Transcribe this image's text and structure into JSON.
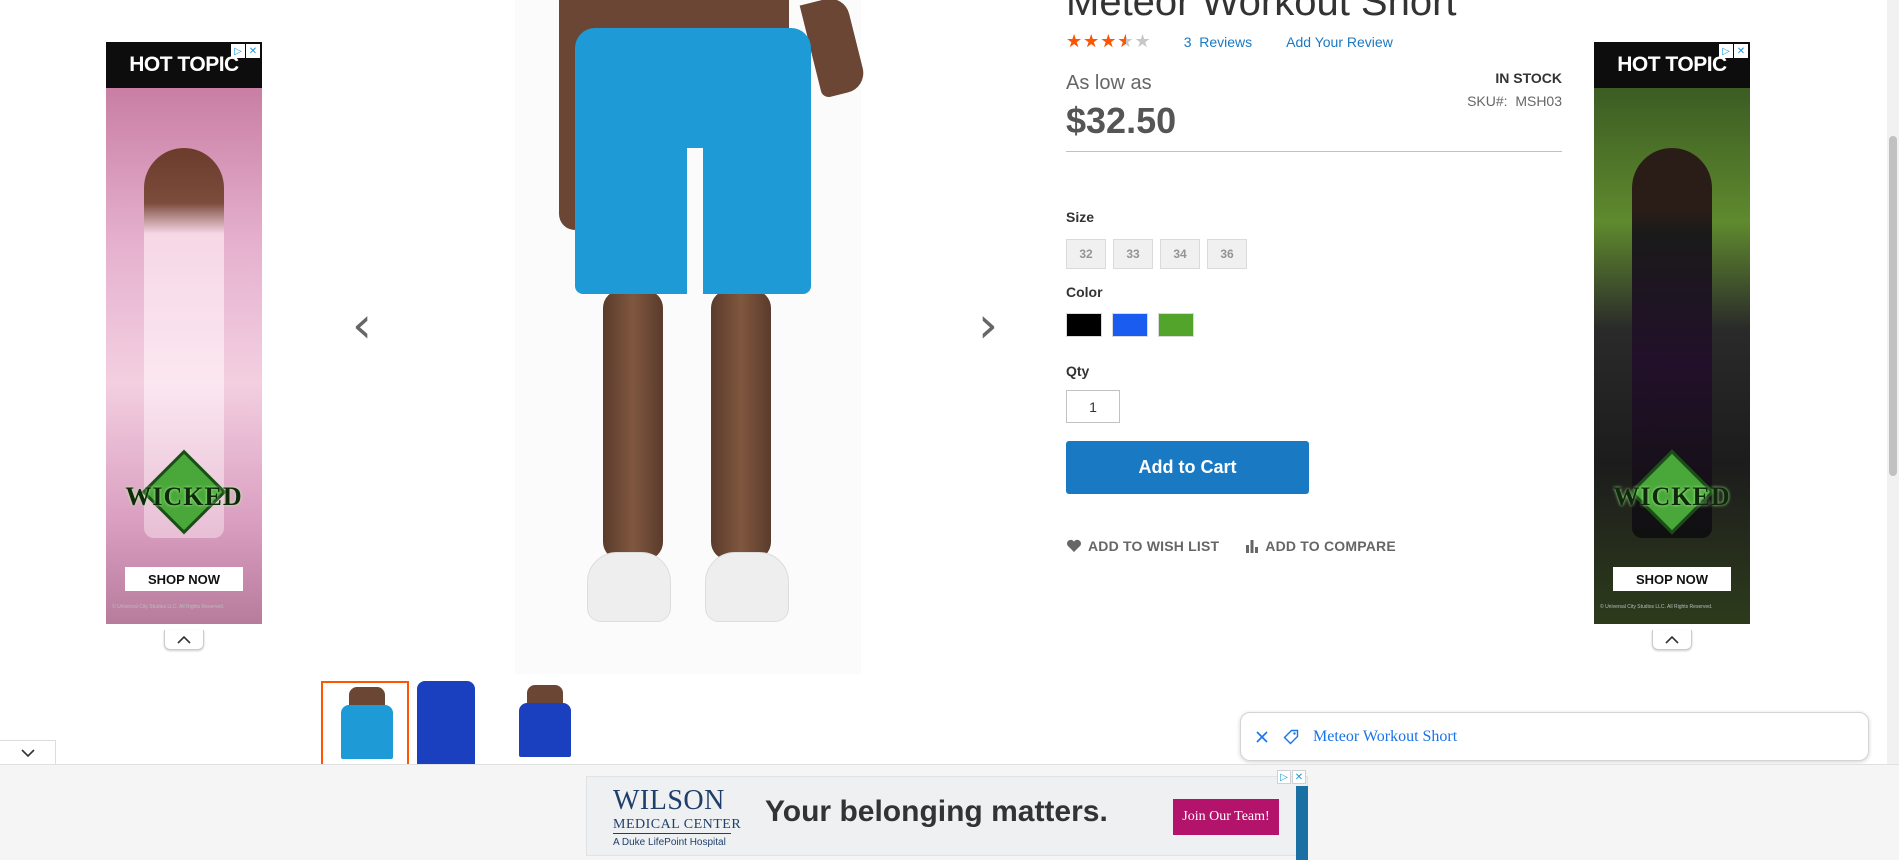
{
  "product": {
    "title": "Meteor Workout Short",
    "rating_fraction": 0.7,
    "stars": "★★★★★",
    "review_count": "3",
    "reviews_label": "Reviews",
    "add_review_label": "Add Your Review",
    "price_label": "As low as",
    "price": "$32.50",
    "stock": "In stock",
    "sku_label": "SKU#:",
    "sku": "MSH03"
  },
  "options": {
    "size_label": "Size",
    "sizes": [
      "32",
      "33",
      "34",
      "36"
    ],
    "color_label": "Color",
    "colors": [
      "#000000",
      "#1a5cf0",
      "#53a42b"
    ],
    "qty_label": "Qty",
    "qty_value": "1"
  },
  "actions": {
    "add_to_cart": "Add to Cart",
    "wishlist": "Add to Wish List",
    "compare": "Add to Compare"
  },
  "gallery": {
    "prev_icon": "‹",
    "next_icon": "›",
    "thumbnail_colors": [
      "#1e9ad6",
      "#1a3fbf",
      "#1a3fbf"
    ]
  },
  "ads": {
    "left": {
      "brand": "HOT TOPIC",
      "tagline": "WICKED",
      "cta": "SHOP NOW",
      "fine_print": "© Universal City Studios LLC. All Rights Reserved."
    },
    "right": {
      "brand": "HOT TOPIC",
      "tagline": "WICKED",
      "cta": "SHOP NOW",
      "fine_print": "© Universal City Studios LLC. All Rights Reserved."
    },
    "bottom": {
      "logo_line1": "WILSON",
      "logo_line2": "MEDICAL CENTER",
      "logo_line3": "A Duke LifePoint Hospital",
      "headline": "Your belonging matters.",
      "cta": "Join Our Team!"
    }
  },
  "search_chip": {
    "text": "Meteor Workout Short"
  },
  "colors": {
    "accent": "#1979c3",
    "star": "#ff5501",
    "active_thumb": "#ff5501"
  }
}
